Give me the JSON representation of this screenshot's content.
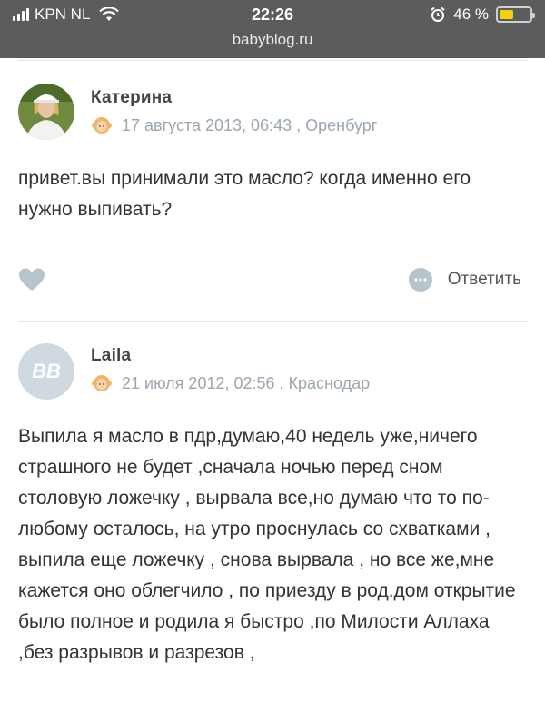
{
  "status_bar": {
    "carrier": "KPN NL",
    "time": "22:26",
    "url": "babyblog.ru",
    "battery_percent_label": "46 %",
    "battery_level": 0.46
  },
  "comments": [
    {
      "author": "Катерина",
      "meta": "17 августа 2013, 06:43 , Оренбург",
      "text": "привет.вы принимали это масло? когда именно его нужно выпивать?",
      "reply_label": "Ответить"
    },
    {
      "author": "Laila",
      "avatar_initials": "BB",
      "meta": "21 июля 2012, 02:56 , Краснодар",
      "text": "Выпила я масло в пдр,думаю,40 недель уже,ничего страшного не будет ,сначала ночью перед сном столовую ложечку , вырвала все,но думаю что то по-любому осталось, на утро проснулась со схватками , выпила еще ложечку , снова вырвала , но все же,мне кажется оно облегчило , по приезду в род.дом открытие было полное и родила я быстро ,по Милости Аллаха ,без разрывов и разрезов ,"
    }
  ],
  "colors": {
    "status_bar_bg": "#5c5c5c",
    "meta_text": "#9aa6b0",
    "icon_gray": "#b8c4cc",
    "battery_fill": "#f5d10b"
  }
}
